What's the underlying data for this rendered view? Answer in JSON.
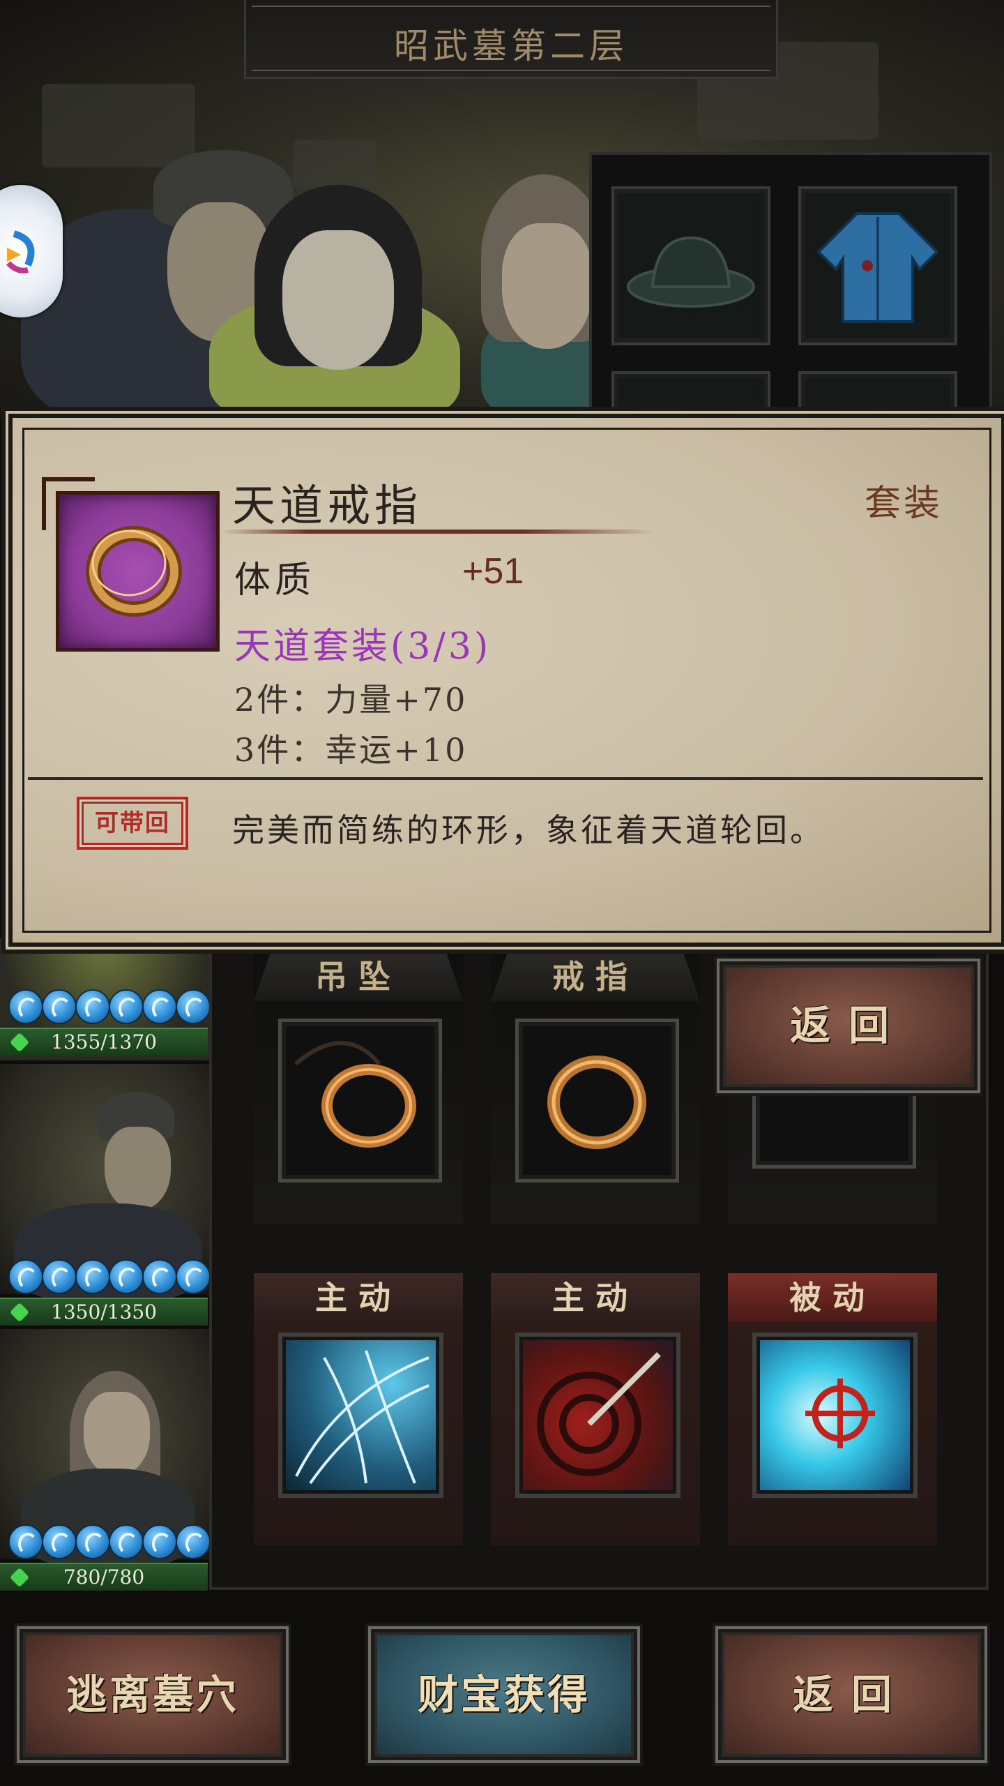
{
  "header": {
    "title": "昭武墓第二层"
  },
  "tooltip": {
    "item_name": "天道戒指",
    "item_type": "套装",
    "stat": {
      "name": "体质",
      "value": "+51"
    },
    "set_title": "天道套装(3/3)",
    "set_bonuses": [
      "2件：力量+70",
      "3件：幸运+10"
    ],
    "bind_stamp": "可带回",
    "description": "完美而简练的环形，象征着天道轮回。"
  },
  "party": [
    {
      "hp": "1355/1370"
    },
    {
      "hp": "1350/1350"
    },
    {
      "hp": "780/780"
    }
  ],
  "equipment_labels": [
    "吊坠",
    "戒指"
  ],
  "skill_labels": [
    "主动",
    "主动",
    "被动"
  ],
  "buttons": {
    "back_panel": "返回",
    "escape": "逃离墓穴",
    "treasure": "财宝获得",
    "back_bottom": "返回"
  },
  "colors": {
    "rarity_purple": "#9a35b8",
    "parchment": "#cfc3ab",
    "hp_green": "#2a5b2c"
  }
}
